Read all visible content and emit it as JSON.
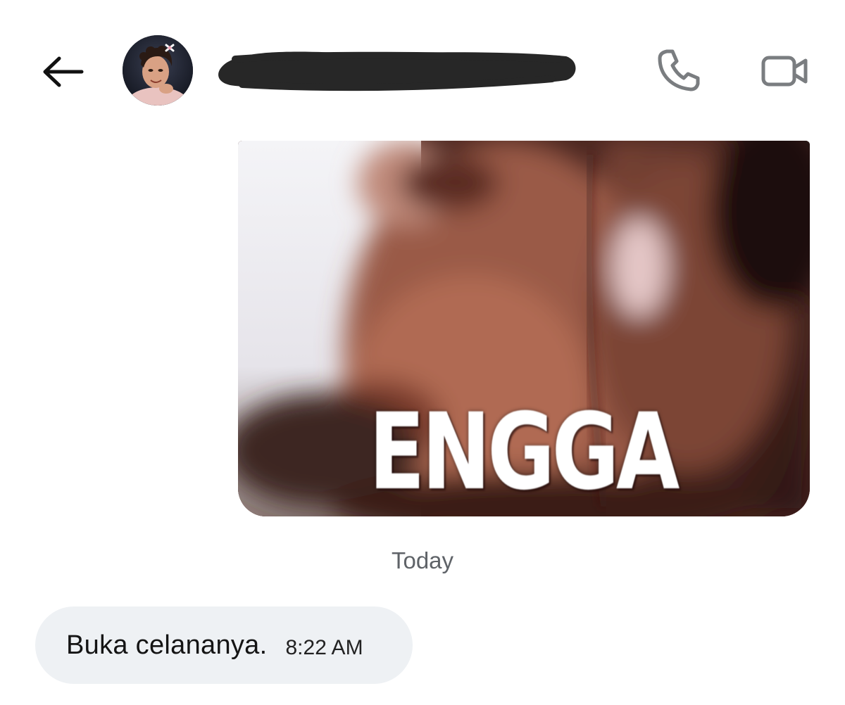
{
  "header": {
    "back_icon": "arrow-left-icon",
    "contact_name": "",
    "contact_name_redacted": true,
    "call_icon": "phone-icon",
    "video_icon": "video-camera-icon",
    "icon_color": "#7a7d80"
  },
  "conversation": {
    "image_message": {
      "caption": "ENGGA",
      "direction": "outgoing"
    },
    "date_separator": "Today",
    "messages": [
      {
        "direction": "incoming",
        "text": "Buka celananya.",
        "time": "8:22 AM",
        "bubble_color": "#eef1f4"
      }
    ]
  }
}
